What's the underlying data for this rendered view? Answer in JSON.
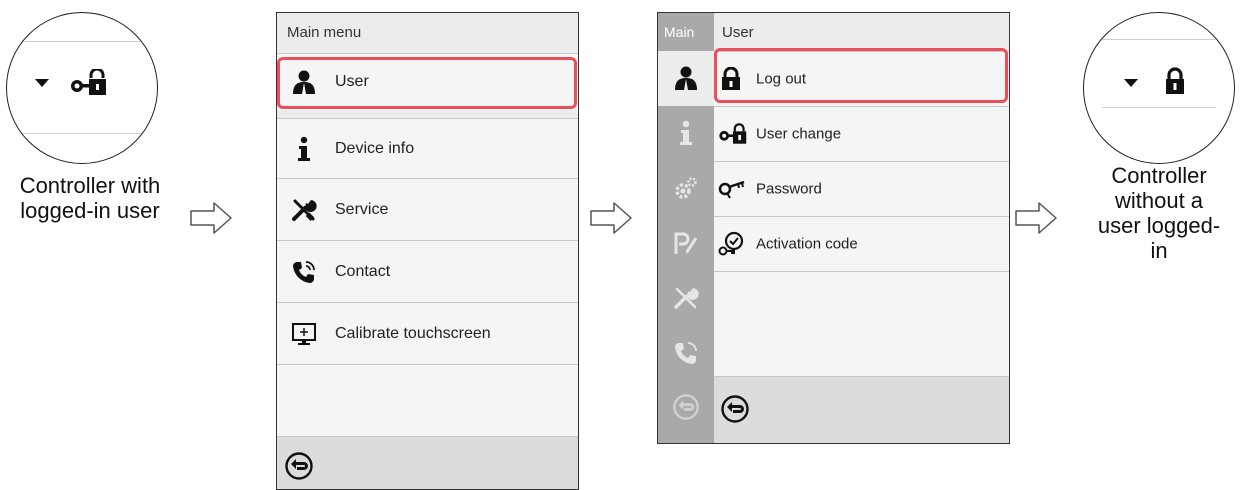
{
  "left_callout": {
    "caption": [
      "Controller with",
      "logged-in user"
    ]
  },
  "right_callout": {
    "caption": [
      "Controller",
      "without a",
      "user logged-",
      "in"
    ]
  },
  "main_menu": {
    "title": "Main menu",
    "items": [
      {
        "label": "User",
        "icon": "user-icon",
        "highlighted": true
      },
      {
        "label": "Device info",
        "icon": "info-icon"
      },
      {
        "label": "Service",
        "icon": "tools-icon"
      },
      {
        "label": "Contact",
        "icon": "phone-icon"
      },
      {
        "label": "Calibrate touchscreen",
        "icon": "touchscreen-icon"
      }
    ],
    "back_icon": "back-icon"
  },
  "user_menu": {
    "sidebar_title": "Main",
    "title": "User",
    "sidebar_items": [
      "user-icon",
      "info-icon",
      "settings-icon",
      "program-icon",
      "tools-icon",
      "phone-icon"
    ],
    "items": [
      {
        "label": "Log out",
        "icon": "lock-icon",
        "highlighted": true
      },
      {
        "label": "User change",
        "icon": "user-change-icon"
      },
      {
        "label": "Password",
        "icon": "key-icon"
      },
      {
        "label": "Activation code",
        "icon": "activation-code-icon"
      }
    ],
    "back_icon": "back-icon"
  },
  "colors": {
    "highlight": "#e8505b",
    "screen_bg": "#ececec",
    "sidebar": "#a9a9a9"
  }
}
